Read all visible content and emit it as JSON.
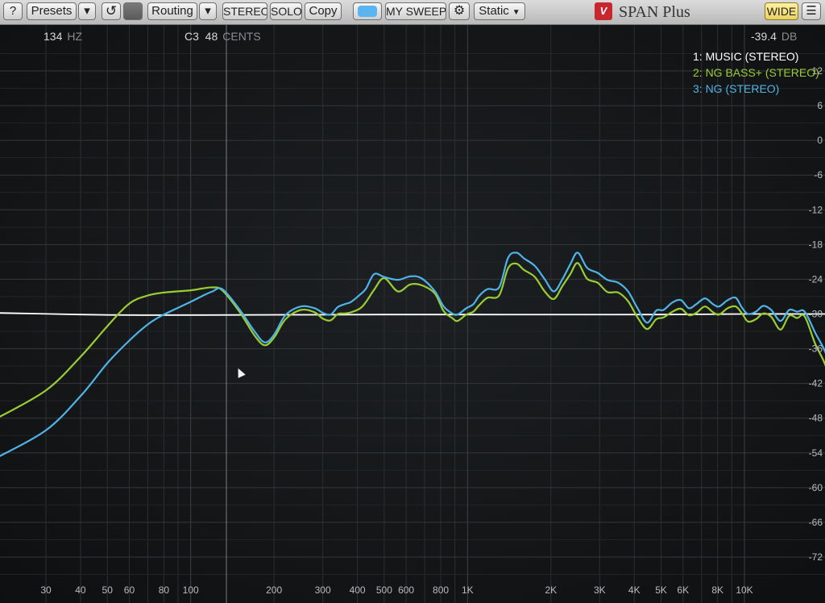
{
  "app": {
    "title": "SPAN Plus",
    "logo_text": "V"
  },
  "toolbar": {
    "help_label": "?",
    "presets_label": "Presets",
    "presets_dropdown_label": "▾",
    "reset_label": "↺",
    "routing_label": "Routing",
    "routing_dropdown_label": "▾",
    "stereo_label": "STEREO",
    "solo_label": "SOLO",
    "copy_label": "Copy",
    "sweep_label": "MY SWEEP",
    "settings_label": "⚙",
    "mode_label": "Static",
    "wide_label": "WIDE",
    "menu_label": "☰"
  },
  "readout": {
    "freq_value": "134",
    "freq_unit": "HZ",
    "note_value": "C3  48",
    "note_unit": "CENTS",
    "level_value": "-39.4",
    "level_unit": "DB"
  },
  "colors": {
    "music": "#ffffff",
    "ng_bass": "#9acd32",
    "ng": "#4fb3e8",
    "panel_bg": "#141618",
    "wide_button": "#f2e07a",
    "sweep_button": "#5ab4ef"
  },
  "legend": [
    {
      "label": "1: MUSIC (STEREO)",
      "color": "#ffffff"
    },
    {
      "label": "2: NG BASS+ (STEREO)",
      "color": "#9acd32"
    },
    {
      "label": "3: NG (STEREO)",
      "color": "#4fb3e8"
    }
  ],
  "chart_data": {
    "type": "line",
    "x_scale": "log",
    "x_unit": "Hz",
    "xlim": [
      20,
      22000
    ],
    "ylim": [
      -78,
      15
    ],
    "grid": true,
    "legend_position": "top-right",
    "x_tick_labels": [
      "30",
      "40",
      "50",
      "60",
      "80",
      "100",
      "200",
      "300",
      "400",
      "500",
      "600",
      "800",
      "1K",
      "2K",
      "3K",
      "4K",
      "5K",
      "6K",
      "8K",
      "10K"
    ],
    "x_ticks": [
      30,
      40,
      50,
      60,
      80,
      100,
      200,
      300,
      400,
      500,
      600,
      800,
      1000,
      2000,
      3000,
      4000,
      5000,
      6000,
      8000,
      10000
    ],
    "y_ticks": [
      12,
      6,
      0,
      -6,
      -12,
      -18,
      -24,
      -30,
      -36,
      -42,
      -48,
      -54,
      -60,
      -66,
      -72
    ],
    "series": [
      {
        "name": "1: MUSIC (STEREO)",
        "color": "#ffffff",
        "x": [
          20,
          40,
          60,
          100,
          500,
          1000,
          5000,
          10000,
          20000
        ],
        "y": [
          -29.8,
          -30.1,
          -30.2,
          -30.2,
          -30.1,
          -30.1,
          -30.1,
          -30.0,
          -30.0
        ]
      },
      {
        "name": "2: NG BASS+ (STEREO)",
        "color": "#9acd32",
        "x": [
          20,
          30,
          40,
          50,
          60,
          70,
          80,
          100,
          110,
          120,
          130,
          150,
          170,
          185,
          200,
          220,
          250,
          280,
          300,
          320,
          340,
          360,
          380,
          410,
          430,
          460,
          500,
          560,
          620,
          680,
          760,
          820,
          880,
          920,
          990,
          1050,
          1100,
          1180,
          1300,
          1400,
          1500,
          1600,
          1750,
          1900,
          2050,
          2200,
          2350,
          2500,
          2700,
          2950,
          3200,
          3500,
          3800,
          4100,
          4450,
          4800,
          5100,
          5500,
          5900,
          6300,
          6700,
          7200,
          7700,
          8100,
          8700,
          9300,
          9800,
          10300,
          11000,
          11700,
          12500,
          13500,
          14500,
          15500,
          16500,
          18000,
          20000,
          22000
        ],
        "y": [
          -48.0,
          -43.2,
          -37.4,
          -32.1,
          -28.2,
          -26.8,
          -26.3,
          -25.9,
          -25.6,
          -25.4,
          -25.9,
          -29.6,
          -33.7,
          -35.4,
          -34.1,
          -30.9,
          -29.3,
          -29.7,
          -30.8,
          -31.1,
          -30.0,
          -29.9,
          -29.7,
          -29.0,
          -27.9,
          -25.8,
          -23.8,
          -26.1,
          -24.9,
          -25.0,
          -26.4,
          -29.5,
          -30.7,
          -31.2,
          -30.1,
          -29.6,
          -28.5,
          -27.2,
          -26.8,
          -22.1,
          -21.3,
          -22.4,
          -23.6,
          -26.1,
          -27.4,
          -25.2,
          -23.1,
          -21.2,
          -23.9,
          -24.6,
          -26.2,
          -26.3,
          -27.8,
          -30.5,
          -32.6,
          -30.9,
          -30.6,
          -29.6,
          -29.1,
          -30.2,
          -29.8,
          -28.7,
          -29.7,
          -30.1,
          -29.0,
          -28.7,
          -29.9,
          -31.3,
          -30.9,
          -29.9,
          -30.5,
          -32.7,
          -30.3,
          -30.7,
          -30.4,
          -35.1,
          -40.1,
          -49.8
        ]
      },
      {
        "name": "3: NG (STEREO)",
        "color": "#4fb3e8",
        "x": [
          20,
          30,
          40,
          50,
          60,
          70,
          80,
          100,
          110,
          120,
          130,
          150,
          170,
          185,
          200,
          220,
          250,
          280,
          300,
          320,
          340,
          360,
          380,
          410,
          430,
          460,
          500,
          560,
          620,
          680,
          760,
          820,
          880,
          920,
          990,
          1050,
          1100,
          1180,
          1300,
          1400,
          1500,
          1600,
          1750,
          1900,
          2050,
          2200,
          2350,
          2500,
          2700,
          2950,
          3200,
          3500,
          3800,
          4100,
          4450,
          4800,
          5100,
          5500,
          5900,
          6300,
          6700,
          7200,
          7700,
          8100,
          8700,
          9300,
          9800,
          10300,
          11000,
          11700,
          12500,
          13500,
          14500,
          15500,
          16500,
          18000,
          20000,
          22000
        ],
        "y": [
          -54.8,
          -50.1,
          -44.2,
          -38.5,
          -34.6,
          -31.8,
          -30.1,
          -27.9,
          -26.9,
          -26.1,
          -25.7,
          -29.2,
          -33.0,
          -34.9,
          -33.6,
          -30.2,
          -28.7,
          -29.0,
          -29.8,
          -30.1,
          -28.8,
          -28.3,
          -27.9,
          -26.6,
          -25.6,
          -23.1,
          -23.6,
          -24.1,
          -23.5,
          -23.8,
          -26.0,
          -28.7,
          -29.9,
          -30.1,
          -29.0,
          -28.3,
          -26.9,
          -25.7,
          -25.4,
          -20.3,
          -19.4,
          -20.4,
          -21.7,
          -24.0,
          -26.1,
          -24.0,
          -21.4,
          -19.4,
          -22.0,
          -22.9,
          -24.1,
          -24.6,
          -26.1,
          -28.9,
          -31.5,
          -29.4,
          -29.3,
          -28.0,
          -27.6,
          -29.0,
          -28.3,
          -27.3,
          -28.3,
          -28.7,
          -27.6,
          -27.2,
          -28.9,
          -30.0,
          -29.6,
          -28.6,
          -29.3,
          -31.2,
          -29.3,
          -29.6,
          -29.6,
          -33.2,
          -37.8,
          -46.7
        ]
      }
    ]
  }
}
